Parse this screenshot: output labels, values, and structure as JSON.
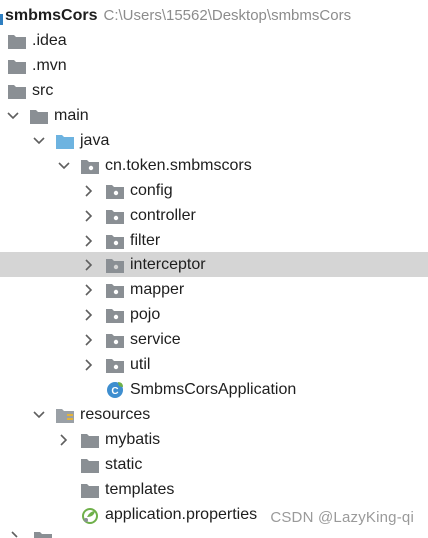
{
  "project": {
    "name": "smbmsCors",
    "path": "C:\\Users\\15562\\Desktop\\smbmsCors"
  },
  "tree": {
    "idea": ".idea",
    "mvn": ".mvn",
    "src": "src",
    "main": "main",
    "java": "java",
    "package": "cn.token.smbmscors",
    "config": "config",
    "controller": "controller",
    "filter": "filter",
    "interceptor": "interceptor",
    "mapper": "mapper",
    "pojo": "pojo",
    "service": "service",
    "util": "util",
    "app_class": "SmbmsCorsApplication",
    "resources": "resources",
    "mybatis": "mybatis",
    "static": "static",
    "templates": "templates",
    "properties": "application.properties"
  },
  "watermark": "CSDN @LazyKing-qi",
  "colors": {
    "folder": "#8a8f94",
    "source_folder": "#6db3e0",
    "resource_folder": "#9aa0a6",
    "resource_stripe": "#e4b33a",
    "selected_row": "#d5d5d5",
    "spring_leaf": "#6fb04a",
    "class_badge": "#3e8ecf"
  },
  "selected_item": "interceptor"
}
